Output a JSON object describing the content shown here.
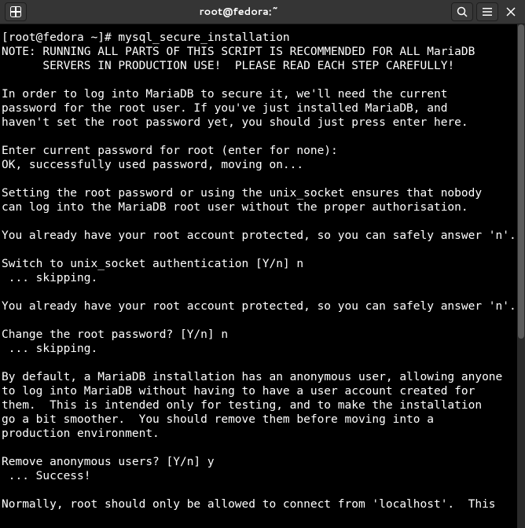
{
  "titlebar": {
    "title": "root@fedora:~"
  },
  "terminal": {
    "lines": [
      "[root@fedora ~]# mysql_secure_installation",
      "NOTE: RUNNING ALL PARTS OF THIS SCRIPT IS RECOMMENDED FOR ALL MariaDB",
      "      SERVERS IN PRODUCTION USE!  PLEASE READ EACH STEP CAREFULLY!",
      "",
      "In order to log into MariaDB to secure it, we'll need the current",
      "password for the root user. If you've just installed MariaDB, and",
      "haven't set the root password yet, you should just press enter here.",
      "",
      "Enter current password for root (enter for none):",
      "OK, successfully used password, moving on...",
      "",
      "Setting the root password or using the unix_socket ensures that nobody",
      "can log into the MariaDB root user without the proper authorisation.",
      "",
      "You already have your root account protected, so you can safely answer 'n'.",
      "",
      "Switch to unix_socket authentication [Y/n] n",
      " ... skipping.",
      "",
      "You already have your root account protected, so you can safely answer 'n'.",
      "",
      "Change the root password? [Y/n] n",
      " ... skipping.",
      "",
      "By default, a MariaDB installation has an anonymous user, allowing anyone",
      "to log into MariaDB without having to have a user account created for",
      "them.  This is intended only for testing, and to make the installation",
      "go a bit smoother.  You should remove them before moving into a",
      "production environment.",
      "",
      "Remove anonymous users? [Y/n] y",
      " ... Success!",
      "",
      "Normally, root should only be allowed to connect from 'localhost'.  This"
    ]
  }
}
